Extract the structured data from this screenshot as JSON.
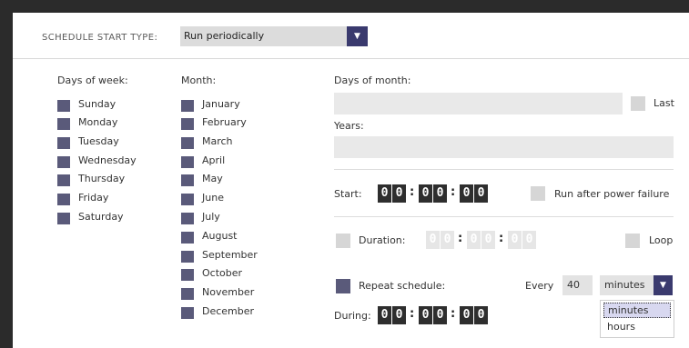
{
  "schedule": {
    "label": "SCHEDULE START TYPE:",
    "selected": "Run periodically"
  },
  "days_of_week": {
    "heading": "Days of week:",
    "items": [
      "Sunday",
      "Monday",
      "Tuesday",
      "Wednesday",
      "Thursday",
      "Friday",
      "Saturday"
    ]
  },
  "months": {
    "heading": "Month:",
    "items": [
      "January",
      "February",
      "March",
      "April",
      "May",
      "June",
      "July",
      "August",
      "September",
      "October",
      "November",
      "December"
    ]
  },
  "days_of_month": {
    "heading": "Days of month:",
    "last_label": "Last",
    "value": ""
  },
  "years": {
    "heading": "Years:",
    "value": ""
  },
  "start": {
    "label": "Start:",
    "digits": [
      "0",
      "0",
      "0",
      "0",
      "0",
      "0"
    ],
    "run_after_power_failure_label": "Run after power failure"
  },
  "duration": {
    "label": "Duration:",
    "digits": [
      "0",
      "0",
      "0",
      "0",
      "0",
      "0"
    ],
    "loop_label": "Loop"
  },
  "repeat": {
    "label": "Repeat schedule:",
    "every_label": "Every",
    "every_value": "40",
    "unit_selected": "minutes",
    "unit_options": [
      "minutes",
      "hours"
    ],
    "during_label": "During:",
    "during_digits": [
      "0",
      "0",
      "0",
      "0",
      "0",
      "0"
    ]
  },
  "colors": {
    "checkbox_checked": "#5a5a7a",
    "select_arrow_bg": "#3a3a6e",
    "digit_bg": "#2e2e2e",
    "field_bg": "#e9e9e9",
    "frame_bg": "#2b2b2b"
  },
  "icons": {
    "select_arrow": "chevron-down-icon"
  }
}
